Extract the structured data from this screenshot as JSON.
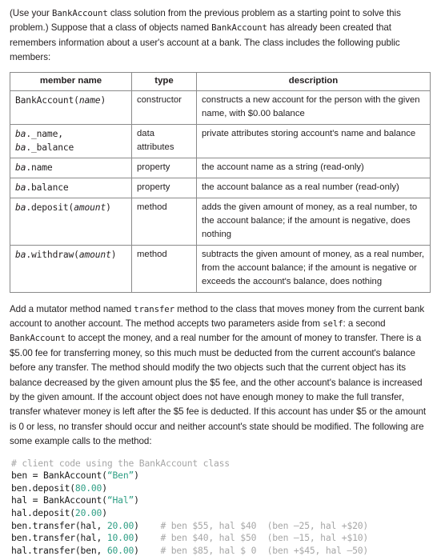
{
  "intro": {
    "text": "(Use your BankAccount class solution from the previous problem as a starting point to solve this problem.) Suppose that a class of objects named BankAccount has already been created that remembers information about a user's account at a bank. The class includes the following public members:",
    "inline_code_1": "BankAccount",
    "inline_code_2": "BankAccount"
  },
  "table": {
    "headers": [
      "member name",
      "type",
      "description"
    ],
    "rows": [
      {
        "member_prefix": "BankAccount(",
        "member_italic": "name",
        "member_suffix": ")",
        "type": "constructor",
        "description": "constructs a new account for the person with the given name, with $0.00 balance"
      },
      {
        "member_line1_italic": "ba",
        "member_line1_rest": "._name,",
        "member_line2_italic": "ba",
        "member_line2_rest": "._balance",
        "type": "data attributes",
        "description": "private attributes storing account's name and balance"
      },
      {
        "member_italic": "ba",
        "member_rest": ".name",
        "type": "property",
        "description": "the account name as a string (read-only)"
      },
      {
        "member_italic": "ba",
        "member_rest": ".balance",
        "type": "property",
        "description": "the account balance as a real number (read-only)"
      },
      {
        "member_italic": "ba",
        "member_rest": ".deposit(",
        "member_arg": "amount",
        "member_close": ")",
        "type": "method",
        "description": "adds the given amount of money, as a real number, to the account balance; if the amount is negative, does nothing"
      },
      {
        "member_italic": "ba",
        "member_rest": ".withdraw(",
        "member_arg": "amount",
        "member_close": ")",
        "type": "method",
        "description": "subtracts the given amount of money, as a real number, from the account balance; if the amount is negative or exceeds the account's balance, does nothing"
      }
    ]
  },
  "body": {
    "part1": "Add a mutator method named ",
    "code1": "transfer",
    "part2": " method to the class that moves money from the current bank account to another account. The method accepts two parameters aside from ",
    "code2": "self",
    "part3": ": a second ",
    "code3": "BankAccount",
    "part4": " to accept the money, and a real number for the amount of money to transfer. There is a $5.00 fee for transferring money, so this much must be deducted from the current account's balance before any transfer. The method should modify the two objects such that the current object has its balance decreased by the given amount plus the $5 fee, and the other account's balance is increased by the given amount. If the account object does not have enough money to make the full transfer, transfer whatever money is left after the $5 fee is deducted. If this account has under $5 or the amount is 0 or less, no transfer should occur and neither account's state should be modified. The following are some example calls to the method:"
  },
  "code": {
    "lines": [
      {
        "segments": [
          {
            "t": "# client code using the BankAccount class",
            "c": "cmt"
          }
        ]
      },
      {
        "segments": [
          {
            "t": "ben = BankAccount(",
            "c": ""
          },
          {
            "t": "“Ben”",
            "c": "str"
          },
          {
            "t": ")",
            "c": ""
          }
        ]
      },
      {
        "segments": [
          {
            "t": "ben.deposit(",
            "c": ""
          },
          {
            "t": "80.00",
            "c": "num"
          },
          {
            "t": ")",
            "c": ""
          }
        ]
      },
      {
        "segments": [
          {
            "t": "hal = BankAccount(",
            "c": ""
          },
          {
            "t": "“Hal”",
            "c": "str"
          },
          {
            "t": ")",
            "c": ""
          }
        ]
      },
      {
        "segments": [
          {
            "t": "hal.deposit(",
            "c": ""
          },
          {
            "t": "20.00",
            "c": "num"
          },
          {
            "t": ")",
            "c": ""
          }
        ]
      },
      {
        "segments": [
          {
            "t": "ben.transfer(hal, ",
            "c": ""
          },
          {
            "t": "20.00",
            "c": "num"
          },
          {
            "t": ")    ",
            "c": ""
          },
          {
            "t": "# ben $55, hal $40  (ben –25, hal +$20)",
            "c": "cmt"
          }
        ]
      },
      {
        "segments": [
          {
            "t": "ben.transfer(hal, ",
            "c": ""
          },
          {
            "t": "10.00",
            "c": "num"
          },
          {
            "t": ")    ",
            "c": ""
          },
          {
            "t": "# ben $40, hal $50  (ben –15, hal +$10)",
            "c": "cmt"
          }
        ]
      },
      {
        "segments": [
          {
            "t": "hal.transfer(ben, ",
            "c": ""
          },
          {
            "t": "60.00",
            "c": "num"
          },
          {
            "t": ")    ",
            "c": ""
          },
          {
            "t": "# ben $85, hal $ 0  (ben +$45, hal –50)",
            "c": "cmt"
          }
        ]
      }
    ]
  },
  "colors": {
    "text": "#231f20",
    "border": "#8a8a8a",
    "comment": "#a6a6a6",
    "string": "#2e9e84"
  }
}
